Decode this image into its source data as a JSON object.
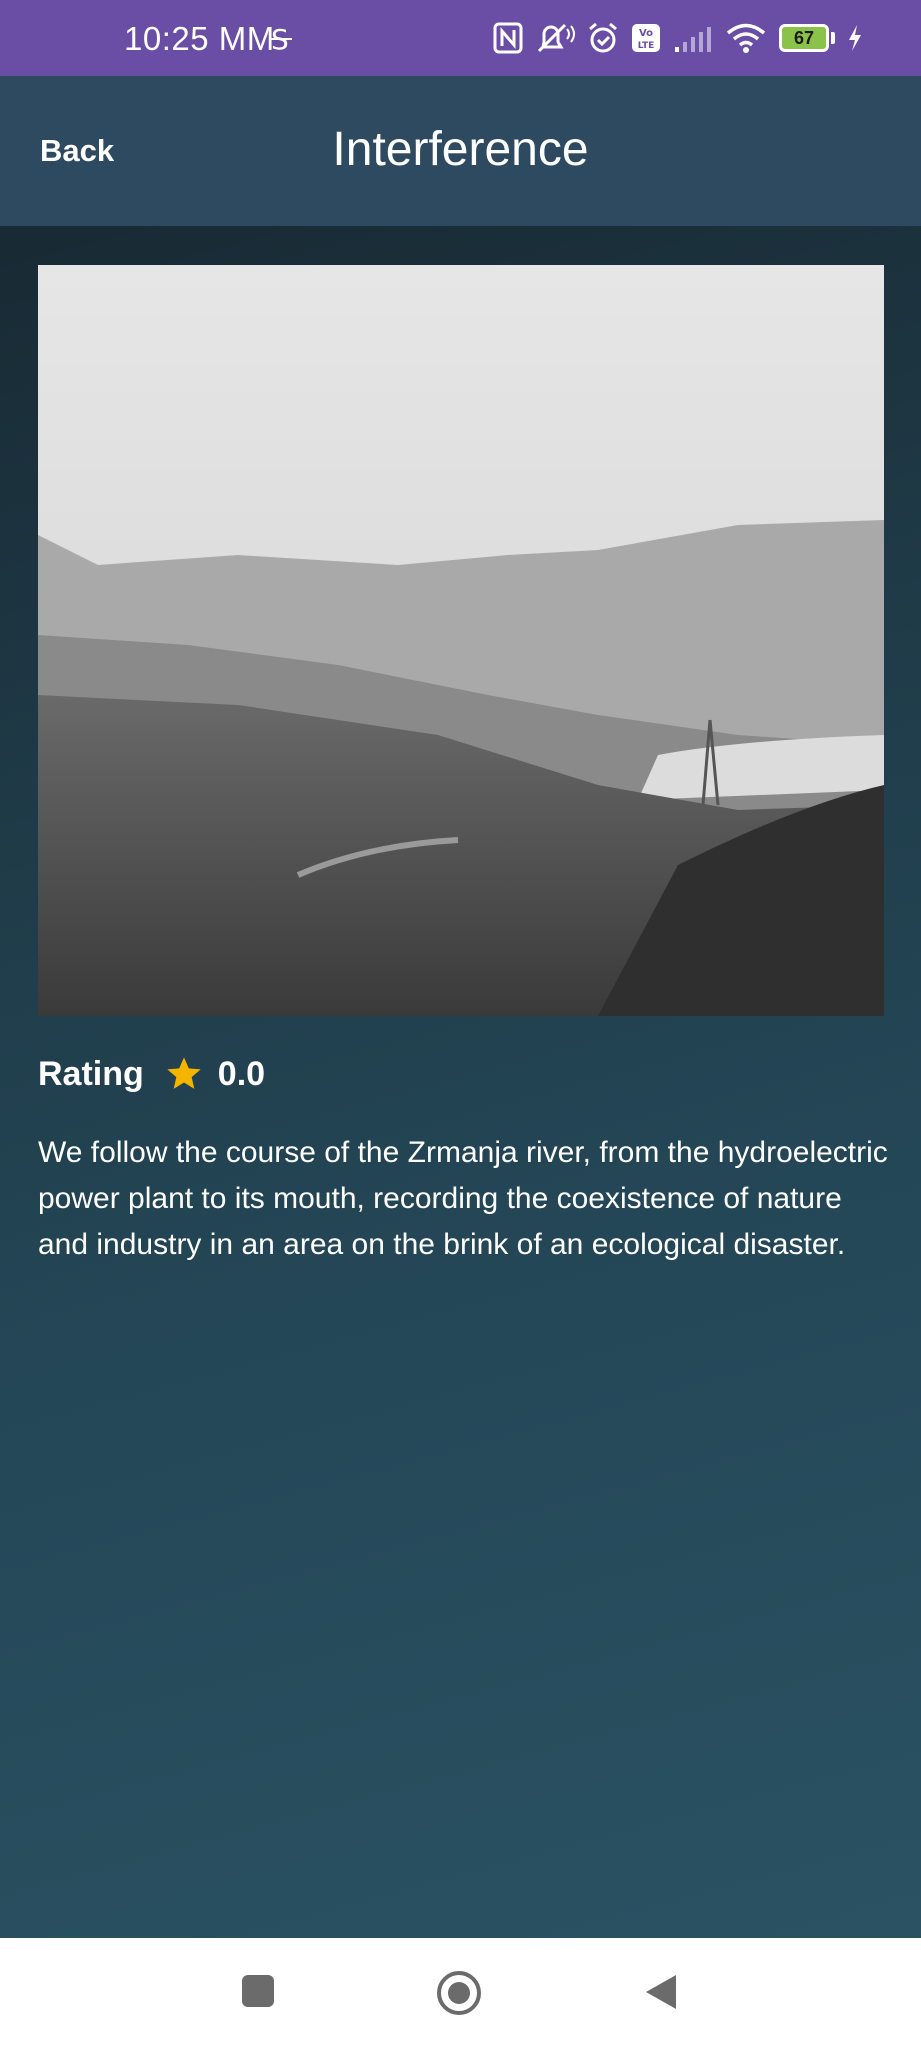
{
  "status_bar": {
    "time": "10:25 MM",
    "battery_level": "67",
    "icons": [
      "s-coin-icon",
      "nfc-icon",
      "mute-icon",
      "alarm-icon",
      "volte-icon",
      "signal-icon",
      "wifi-icon",
      "battery-icon",
      "charging-icon"
    ]
  },
  "header": {
    "back_label": "Back",
    "title": "Interference"
  },
  "movie": {
    "poster_description_icon": "landscape-photo",
    "rating_label": "Rating",
    "rating_value": "0.0",
    "description": "We follow the course of the Zrmanja river, from the hydroelectric power plant to its mouth, recording the coexistence of nature and industry in an area on the brink of an ecological disaster."
  },
  "nav_bar": {
    "icons": [
      "recents-square-icon",
      "home-circle-icon",
      "back-triangle-icon"
    ]
  },
  "colors": {
    "status_bar": "#6a4ea6",
    "app_bar": "#2e4a60",
    "content_top": "#182a34",
    "content_bottom": "#2a5263",
    "star": "#f5b400",
    "battery": "#8bc34a"
  }
}
